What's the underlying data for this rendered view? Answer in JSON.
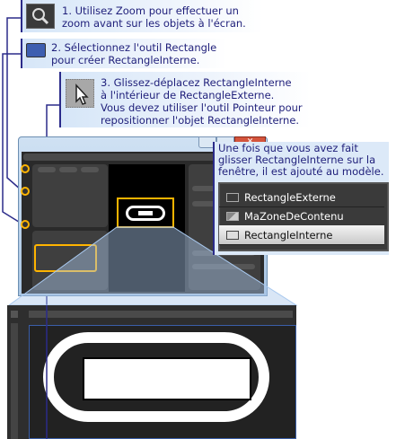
{
  "callouts": [
    {
      "icon": "zoom-icon",
      "lines": [
        "1. Utilisez Zoom pour effectuer un",
        "zoom avant sur les objets à l'écran."
      ]
    },
    {
      "icon": "rectangle-tool-icon",
      "lines": [
        "2. Sélectionnez l'outil Rectangle",
        "pour créer RectangleInterne."
      ]
    },
    {
      "icon": "pointer-icon",
      "lines": [
        "3. Glissez-déplacez RectangleInterne",
        "à l'intérieur de RectangleExterne.",
        "Vous devez utiliser l'outil Pointeur pour",
        "repositionner l'objet RectangleInterne."
      ]
    }
  ],
  "note": {
    "lines": [
      "Une fois que vous avez fait",
      "glisser RectangleInterne sur la",
      "fenêtre, il est ajouté au modèle."
    ]
  },
  "objects_list": [
    {
      "label": "RectangleExterne",
      "selected": false
    },
    {
      "label": "MaZoneDeContenu",
      "selected": false
    },
    {
      "label": "RectangleInterne",
      "selected": true
    }
  ],
  "colors": {
    "callout_text": "#1f1f7a",
    "highlight": "#ffb400",
    "selected": "#e6e6e6"
  }
}
